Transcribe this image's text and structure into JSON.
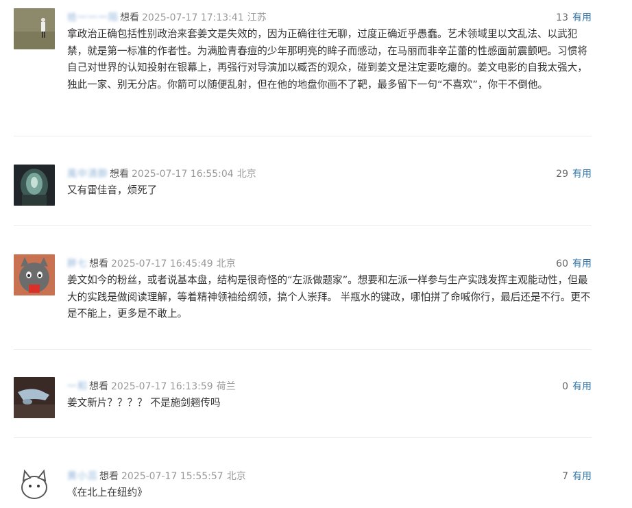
{
  "comments": [
    {
      "username": "拾一一一陌",
      "status": "想看",
      "time": "2025-07-17 17:13:41",
      "location": "江苏",
      "votes": "13",
      "useful_label": "有用",
      "content": "拿政治正确包括性别政治来套姜文是失效的，因为正确往往无聊，过度正确近乎愚蠢。艺术领域里以文乱法、以武犯禁，就是第一标准的作者性。为满脸青春痘的少年那明亮的眸子而感动，在马丽而非辛芷蕾的性感面前震颤吧。习惯将自己对世界的认知投射在银幕上，再强行对导演加以臧否的观众，碰到姜文是注定要吃瘪的。姜文电影的自我太强大，独此一家、别无分店。你箭可以随便乱射，但在他的地盘你画不了靶，最多留下一句“不喜欢”，你干不倒他。"
    },
    {
      "username": "風中清酔",
      "status": "想看",
      "time": "2025-07-17 16:55:04",
      "location": "北京",
      "votes": "29",
      "useful_label": "有用",
      "content": "又有雷佳音，烦死了"
    },
    {
      "username": "胖七",
      "status": "想看",
      "time": "2025-07-17 16:45:49",
      "location": "北京",
      "votes": "60",
      "useful_label": "有用",
      "content": "姜文如今的粉丝，或者说基本盘，结构是很奇怪的“左派做题家”。想要和左派一样参与生产实践发挥主观能动性，但最大的实践是做阅读理解，等着精神领袖给纲领，搞个人崇拜。 半瓶水的键政，哪怕拼了命喊你行，最后还是不行。更不是不能上，更多是不敢上。"
    },
    {
      "username": "一和",
      "status": "想看",
      "time": "2025-07-17 16:13:59",
      "location": "荷兰",
      "votes": "0",
      "useful_label": "有用",
      "content": "姜文新片？？？？ 不是施剑翘传吗"
    },
    {
      "username": "黄小蕊",
      "status": "想看",
      "time": "2025-07-17 15:55:57",
      "location": "北京",
      "votes": "7",
      "useful_label": "有用",
      "content": "《在北上在纽约》"
    }
  ],
  "colors": {
    "link": "#3377aa",
    "meta_gray": "#999999",
    "divider": "#eaeaea"
  }
}
